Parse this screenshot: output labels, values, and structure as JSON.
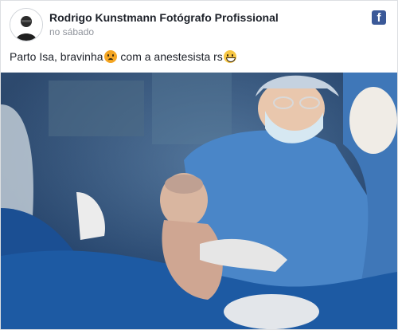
{
  "post": {
    "author": "Rodrigo Kunstmann Fotógrafo Profissional",
    "timestamp": "no sábado",
    "caption_part1": "Parto Isa, bravinha",
    "caption_part2": " com a anestesista rs",
    "network_icon": "facebook-icon",
    "brand_color": "#3b5998"
  }
}
